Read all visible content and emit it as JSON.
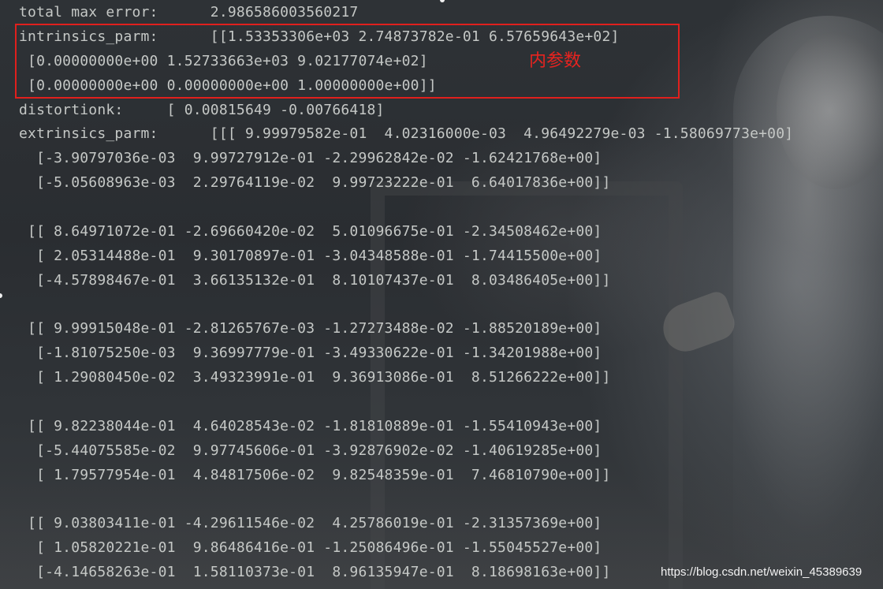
{
  "terminal": {
    "lines": [
      "total max error:      2.986586003560217",
      "intrinsics_parm:      [[1.53353306e+03 2.74873782e-01 6.57659643e+02]",
      " [0.00000000e+00 1.52733663e+03 9.02177074e+02]",
      " [0.00000000e+00 0.00000000e+00 1.00000000e+00]]",
      "distortionk:     [ 0.00815649 -0.00766418]",
      "extrinsics_parm:      [[[ 9.99979582e-01  4.02316000e-03  4.96492279e-03 -1.58069773e+00]",
      "  [-3.90797036e-03  9.99727912e-01 -2.29962842e-02 -1.62421768e+00]",
      "  [-5.05608963e-03  2.29764119e-02  9.99723222e-01  6.64017836e+00]]",
      "",
      " [[ 8.64971072e-01 -2.69660420e-02  5.01096675e-01 -2.34508462e+00]",
      "  [ 2.05314488e-01  9.30170897e-01 -3.04348588e-01 -1.74415500e+00]",
      "  [-4.57898467e-01  3.66135132e-01  8.10107437e-01  8.03486405e+00]]",
      "",
      " [[ 9.99915048e-01 -2.81265767e-03 -1.27273488e-02 -1.88520189e+00]",
      "  [-1.81075250e-03  9.36997779e-01 -3.49330622e-01 -1.34201988e+00]",
      "  [ 1.29080450e-02  3.49323991e-01  9.36913086e-01  8.51266222e+00]]",
      "",
      " [[ 9.82238044e-01  4.64028543e-02 -1.81810889e-01 -1.55410943e+00]",
      "  [-5.44075585e-02  9.97745606e-01 -3.92876902e-02 -1.40619285e+00]",
      "  [ 1.79577954e-01  4.84817506e-02  9.82548359e-01  7.46810790e+00]]",
      "",
      " [[ 9.03803411e-01 -4.29611546e-02  4.25786019e-01 -2.31357369e+00]",
      "  [ 1.05820221e-01  9.86486416e-01 -1.25086496e-01 -1.55045527e+00]",
      "  [-4.14658263e-01  1.58110373e-01  8.96135947e-01  8.18698163e+00]]"
    ]
  },
  "annotation": {
    "label": "内参数",
    "color": "#e0201d"
  },
  "watermark": "https://blog.csdn.net/weixin_45389639",
  "colors": {
    "text": "#c5c8c6",
    "background": "#2a2d31"
  }
}
